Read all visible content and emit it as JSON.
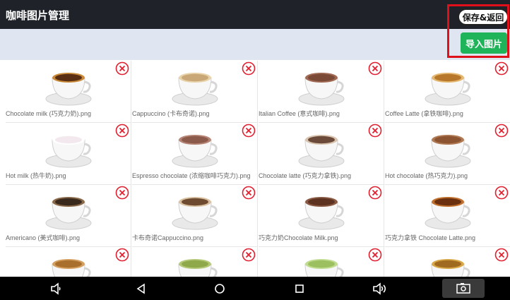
{
  "header": {
    "title": "咖啡图片管理"
  },
  "buttons": {
    "save_back": "保存&返回",
    "import_image": "导入图片"
  },
  "items": [
    {
      "label": "Chocolate milk (巧克力奶).png",
      "coffee_color": "#5a2e12",
      "rim_color": "#c98a3a"
    },
    {
      "label": "Cappuccino (卡布奇诺).png",
      "coffee_color": "#c9a776",
      "rim_color": "#e8d2a8"
    },
    {
      "label": "Italian Coffee (意式咖啡).png",
      "coffee_color": "#7a4a36",
      "rim_color": "#a06a54"
    },
    {
      "label": "Coffee Latte (拿铁咖啡).png",
      "coffee_color": "#b8782c",
      "rim_color": "#e4b870"
    },
    {
      "label": "Hot milk (热牛奶).png",
      "coffee_color": "#f3e8ee",
      "rim_color": "#ffffff"
    },
    {
      "label": "Espresso chocolate (浓缩咖啡巧克力).png",
      "coffee_color": "#8b5a4a",
      "rim_color": "#b58474"
    },
    {
      "label": "Chocolate latte (巧克力拿铁).png",
      "coffee_color": "#6b4a3a",
      "rim_color": "#d9c4b0"
    },
    {
      "label": "Hot chocolate (热巧克力).png",
      "coffee_color": "#8c5430",
      "rim_color": "#b07a54"
    },
    {
      "label": "Americano (美式咖啡).png",
      "coffee_color": "#3a2a1e",
      "rim_color": "#8a6a4a"
    },
    {
      "label": "卡布奇诺Cappuccino.png",
      "coffee_color": "#6e4a30",
      "rim_color": "#d8c0a0"
    },
    {
      "label": "巧克力奶Chocolate Milk.png",
      "coffee_color": "#5e3220",
      "rim_color": "#8a5a44"
    },
    {
      "label": "巧克力拿铁 Chocolate Latte.png",
      "coffee_color": "#6a3010",
      "rim_color": "#c0702c"
    },
    {
      "label": "",
      "coffee_color": "#a8702c",
      "rim_color": "#d4a060"
    },
    {
      "label": "",
      "coffee_color": "#8fa84a",
      "rim_color": "#b4c878"
    },
    {
      "label": "",
      "coffee_color": "#9cc060",
      "rim_color": "#c0dc90"
    },
    {
      "label": "",
      "coffee_color": "#a06a20",
      "rim_color": "#d8a848"
    }
  ],
  "nav_icons": [
    "volume-down-icon",
    "back-icon",
    "home-icon",
    "recents-icon",
    "volume-up-icon",
    "screenshot-icon"
  ]
}
